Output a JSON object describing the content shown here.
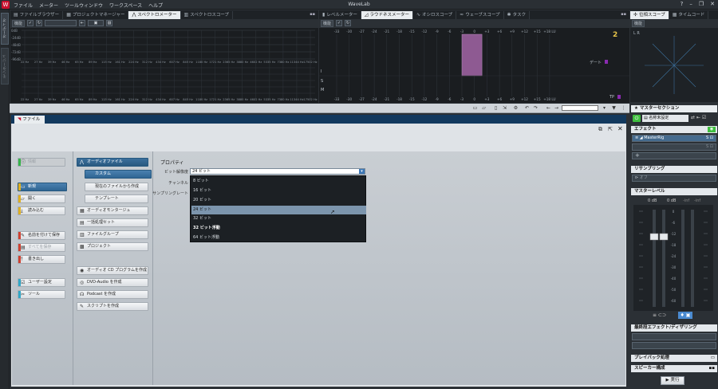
{
  "window": {
    "title": "WaveLab"
  },
  "menu": [
    "ファイル",
    "メーター",
    "ツールウィンドウ",
    "ワークスペース",
    "ヘルプ"
  ],
  "vstrip": [
    "オーディオ",
    "モンタージュ"
  ],
  "top_left": {
    "tabs": [
      {
        "label": "ファイルブラウザー",
        "icon": "folder-icon",
        "active": false
      },
      {
        "label": "プロジェクトマネージャー",
        "icon": "grid-icon",
        "active": false
      },
      {
        "label": "スペクトロメーター",
        "icon": "spectrum-icon",
        "active": true
      },
      {
        "label": "スペクトロスコープ",
        "icon": "scope-icon",
        "active": false
      }
    ],
    "toolbar_label": "機能",
    "freq_labels": [
      "22 Hz",
      "27 Hz",
      "39 Hz",
      "46 Hz",
      "65 Hz",
      "89 Hz",
      "115 Hz",
      "161 Hz",
      "224 Hz",
      "312 Hz",
      "434 Hz",
      "607 Hz",
      "845 Hz",
      "1180 Hz",
      "1721 Hz",
      "2365 Hz",
      "3880 Hz",
      "4602 Hz",
      "5335 Hz",
      "7380 Hz",
      "11344 Hz",
      "17502 Hz"
    ],
    "db_labels": [
      "0dB",
      "-24dB",
      "-48dB",
      "-72dB",
      "-96dB"
    ]
  },
  "top_mid": {
    "tabs": [
      {
        "label": "レベルメーター",
        "icon": "level-icon",
        "active": false
      },
      {
        "label": "ラウドネスメーター",
        "icon": "loudness-icon",
        "active": true
      },
      {
        "label": "オシロスコープ",
        "icon": "osc-icon",
        "active": false
      },
      {
        "label": "ウェーブスコープ",
        "icon": "wave-icon",
        "active": false
      },
      {
        "label": "タスク",
        "icon": "task-icon",
        "active": false
      }
    ],
    "toolbar_label": "機能",
    "lu_scale": [
      "-33",
      "-30",
      "-27",
      "-24",
      "-21",
      "-18",
      "-15",
      "-12",
      "-9",
      "-6",
      "-3",
      "0",
      "+3",
      "+6",
      "+9",
      "+12",
      "+15",
      "+18 LU"
    ],
    "side_labels": [
      "I",
      "S",
      "M"
    ],
    "badge": "2",
    "tp_label": "TP",
    "meter_label": "デート"
  },
  "top_right": {
    "tabs": [
      {
        "label": "位相スコープ",
        "icon": "phase-icon",
        "active": true
      },
      {
        "label": "タイムコード",
        "icon": "timecode-icon",
        "active": false
      }
    ],
    "toolbar_label": "機能"
  },
  "file_tab": "ファイル",
  "left_buttons": {
    "info": "情報",
    "new": "新規",
    "open": "開く",
    "import": "読み込む",
    "save_as": "名前を付けて保存",
    "save_all": "すべてを保存",
    "export": "書き出し",
    "user_settings": "ユーザー設定",
    "tools": "ツール"
  },
  "mid_buttons": {
    "audio_file": "オーディオファイル",
    "custom": "カスタム",
    "from_current": "現在のファイルから作成",
    "template": "テンプレート",
    "audio_montage": "オーディオモンタージュ",
    "batch": "一括処理セット",
    "file_group": "ファイルグループ",
    "project": "プロジェクト",
    "cd_program": "オーディオ CD プログラムを作成",
    "dvd_audio": "DVD-Audio を作成",
    "podcast": "Podcast を作成",
    "script": "スクリプトを作成"
  },
  "properties": {
    "title": "プロパティ",
    "bit_depth_label": "ビット解像度",
    "bit_depth_value": "24 ビット",
    "channel_label": "チャンネル",
    "rate_label": "サンプリングレート",
    "options": [
      "8 ビット",
      "16 ビット",
      "20 ビット",
      "24 ビット",
      "32 ビット",
      "32 ビット浮動",
      "64 ビット浮動"
    ],
    "selected_index": 3
  },
  "master": {
    "title": "マスターセクション",
    "preset": "名称未設定",
    "effects": "エフェクト",
    "effect_slot": "MasterRig",
    "resampling": "リサンプリング",
    "resampling_value": "オフ",
    "master_level": "マスターレベル",
    "level_left": "0 dB",
    "level_right": "0 dB",
    "level_inf": "-inf",
    "meter_scale": [
      "0",
      "-6",
      "-12",
      "-18",
      "-24",
      "-30",
      "-40",
      "-50",
      "-60"
    ],
    "final_effects": "最終段エフェクト/ディザリング",
    "playback": "プレイバック処理",
    "speaker": "スピーカー構成",
    "render": "実行"
  }
}
